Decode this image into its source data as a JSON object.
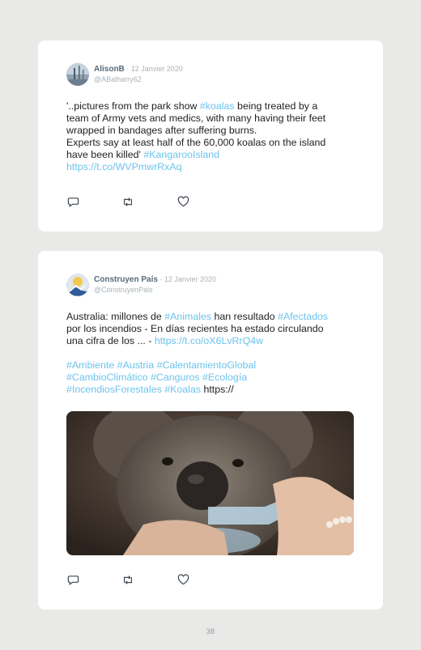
{
  "tweets": [
    {
      "name": "AlisonB",
      "date": " · 12 Janvier 2020",
      "handle": "@ABalharry62",
      "lines": [
        [
          {
            "t": "'..pictures from the park show "
          },
          {
            "t": "#koalas",
            "tag": true
          },
          {
            "t": " being treated by a"
          }
        ],
        [
          {
            "t": "team of Army vets and medics, with many having their feet"
          }
        ],
        [
          {
            "t": "wrapped in bandages after suffering burns."
          }
        ],
        [
          {
            "t": "Experts say at least half of the 60,000 koalas on the island"
          }
        ],
        [
          {
            "t": "have been killed' "
          },
          {
            "t": "#KangarooIsland",
            "tag": true
          }
        ],
        [
          {
            "t": "https://t.co/WVPmwrRxAq",
            "tag": true
          }
        ]
      ]
    },
    {
      "name": "Construyen País",
      "date": " · 12 Janvier 2020",
      "handle": "@ConstruyenPais",
      "lines": [
        [
          {
            "t": "Australia: millones de "
          },
          {
            "t": "#Animales",
            "tag": true
          },
          {
            "t": " han resultado "
          },
          {
            "t": "#Afectados",
            "tag": true
          }
        ],
        [
          {
            "t": "por los incendios - En días recientes ha estado circulando"
          }
        ],
        [
          {
            "t": "una cifra de los ... - "
          },
          {
            "t": "https://t.co/oX6LvRrQ4w",
            "tag": true
          }
        ],
        [
          {
            "t": ""
          }
        ],
        [
          {
            "t": "#Ambiente #Austria #CalentamientoGlobal",
            "tag": true
          }
        ],
        [
          {
            "t": "#CambioClimático #Canguros #Ecología",
            "tag": true
          }
        ],
        [
          {
            "t": "#IncendiosForestales #Koalas",
            "tag": true
          },
          {
            "t": " https://"
          }
        ]
      ]
    }
  ],
  "actions": {
    "reply_icon": "reply-icon",
    "retweet_icon": "retweet-icon",
    "like_icon": "heart-icon"
  },
  "colors": {
    "link": "#6cc3ec",
    "name": "#566b7a",
    "meta": "#a9b3ba",
    "background": "#e9e9e8"
  },
  "page_number": "38"
}
